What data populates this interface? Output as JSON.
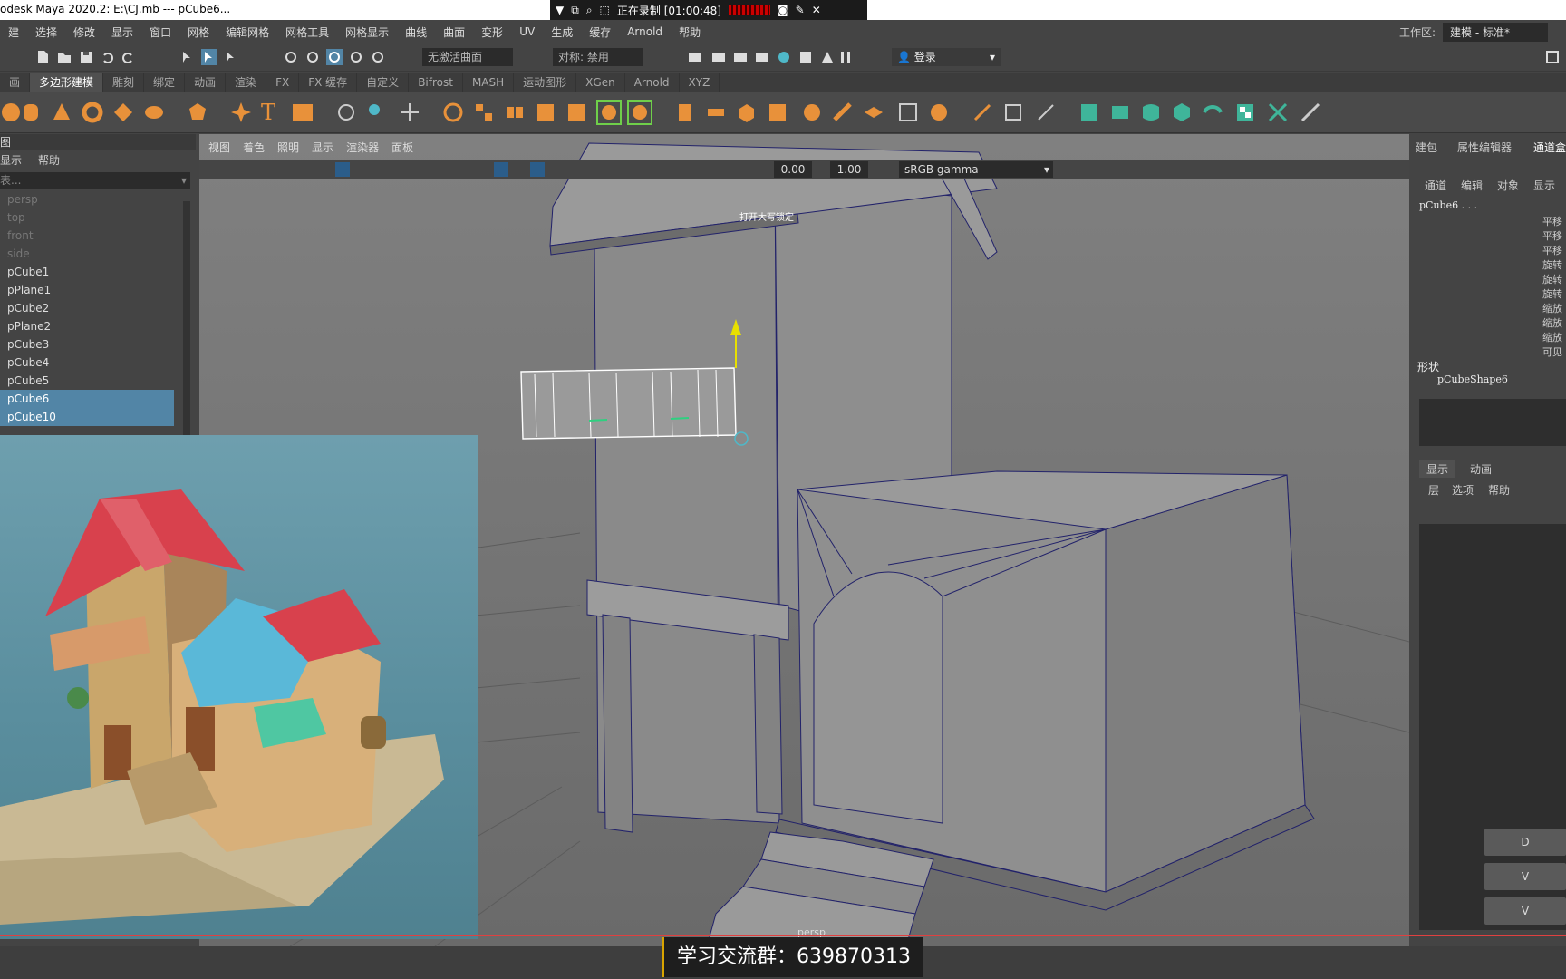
{
  "window": {
    "title": "odesk Maya 2020.2: E:\\CJ.mb   ---   pCube6...",
    "recording_label": "正在录制 [01:00:48]"
  },
  "menu": {
    "items": [
      "建",
      "选择",
      "修改",
      "显示",
      "窗口",
      "网格",
      "编辑网格",
      "网格工具",
      "网格显示",
      "曲线",
      "曲面",
      "变形",
      "UV",
      "生成",
      "缓存",
      "Arnold",
      "帮助"
    ],
    "workspace_label": "工作区:",
    "workspace_value": "建模 - 标准*"
  },
  "status": {
    "live_surface": "无激活曲面",
    "symmetry": "对称: 禁用",
    "login": "登录"
  },
  "shelf": {
    "tabs": [
      "画",
      "多边形建模",
      "雕刻",
      "绑定",
      "动画",
      "渲染",
      "FX",
      "FX 缓存",
      "自定义",
      "Bifrost",
      "MASH",
      "运动图形",
      "XGen",
      "Arnold",
      "XYZ"
    ],
    "active_tab": "多边形建模"
  },
  "outliner": {
    "header": "图",
    "menu": [
      "显示",
      "帮助"
    ],
    "search_placeholder": "表...",
    "items": [
      {
        "label": "persp",
        "state": "dim"
      },
      {
        "label": "top",
        "state": "dim"
      },
      {
        "label": "front",
        "state": "dim"
      },
      {
        "label": "side",
        "state": "dim"
      },
      {
        "label": "pCube1",
        "state": "normal"
      },
      {
        "label": "pPlane1",
        "state": "normal"
      },
      {
        "label": "pCube2",
        "state": "normal"
      },
      {
        "label": "pPlane2",
        "state": "normal"
      },
      {
        "label": "pCube3",
        "state": "normal"
      },
      {
        "label": "pCube4",
        "state": "normal"
      },
      {
        "label": "pCube5",
        "state": "normal"
      },
      {
        "label": "pCube6",
        "state": "selected"
      },
      {
        "label": "pCube10",
        "state": "selected"
      }
    ]
  },
  "viewport": {
    "menu": [
      "视图",
      "着色",
      "照明",
      "显示",
      "渲染器",
      "面板"
    ],
    "exposure": "0.00",
    "gamma": "1.00",
    "color_space": "sRGB gamma",
    "camera_label": "persp",
    "hud_text": "打开大写锁定"
  },
  "channelbox": {
    "tabs": [
      "建包",
      "属性编辑器",
      "通道盒"
    ],
    "menu": [
      "通道",
      "编辑",
      "对象",
      "显示"
    ],
    "object_name": "pCube6 . . .",
    "attrs": [
      "平移",
      "平移",
      "平移",
      "旋转",
      "旋转",
      "旋转",
      "缩放",
      "缩放",
      "缩放",
      "可见"
    ],
    "shape_label": "形状",
    "shape_name": "pCubeShape6",
    "layer_tabs": [
      "显示",
      "动画"
    ],
    "layer_menu": [
      "层",
      "选项",
      "帮助"
    ],
    "buttons": [
      "D",
      "V",
      "V"
    ]
  },
  "overlay": {
    "banner": "学习交流群：639870313"
  }
}
